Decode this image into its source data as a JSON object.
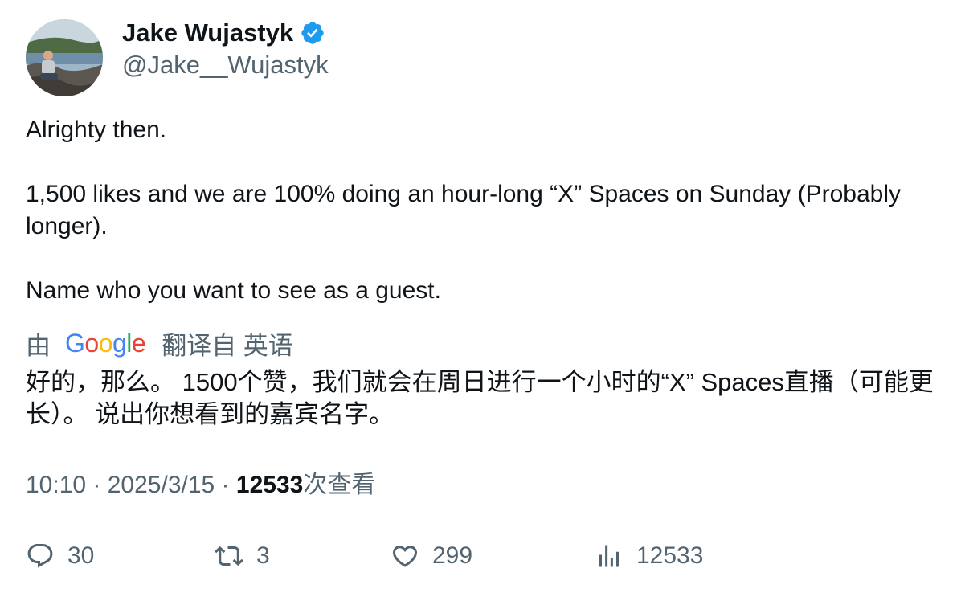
{
  "author": {
    "display_name": "Jake Wujastyk",
    "handle": "@Jake__Wujastyk",
    "verified": true
  },
  "tweet": {
    "text": "Alrighty then.\n\n1,500 likes and we are 100% doing an hour-long “X” Spaces on Sunday (Probably longer).\n\nName who you want to see as a guest."
  },
  "translation": {
    "by_label": "由",
    "provider": "Google",
    "from_label": "翻译自 英语",
    "text": "好的，那么。 1500个赞，我们就会在周日进行一个小时的“X” Spaces直播（可能更长）。 说出你想看到的嘉宾名字。"
  },
  "meta": {
    "time": "10:10",
    "separator": " · ",
    "date": "2025/3/15",
    "views_count": "12533",
    "views_label": "次查看"
  },
  "actions": {
    "reply_count": "30",
    "retweet_count": "3",
    "like_count": "299",
    "views_count": "12533"
  },
  "colors": {
    "text_primary": "#0f1419",
    "text_secondary": "#536471",
    "verified_blue": "#1d9bf0",
    "google_blue": "#4285f4",
    "google_red": "#ea4335",
    "google_yellow": "#fbbc05",
    "google_green": "#34a853"
  }
}
